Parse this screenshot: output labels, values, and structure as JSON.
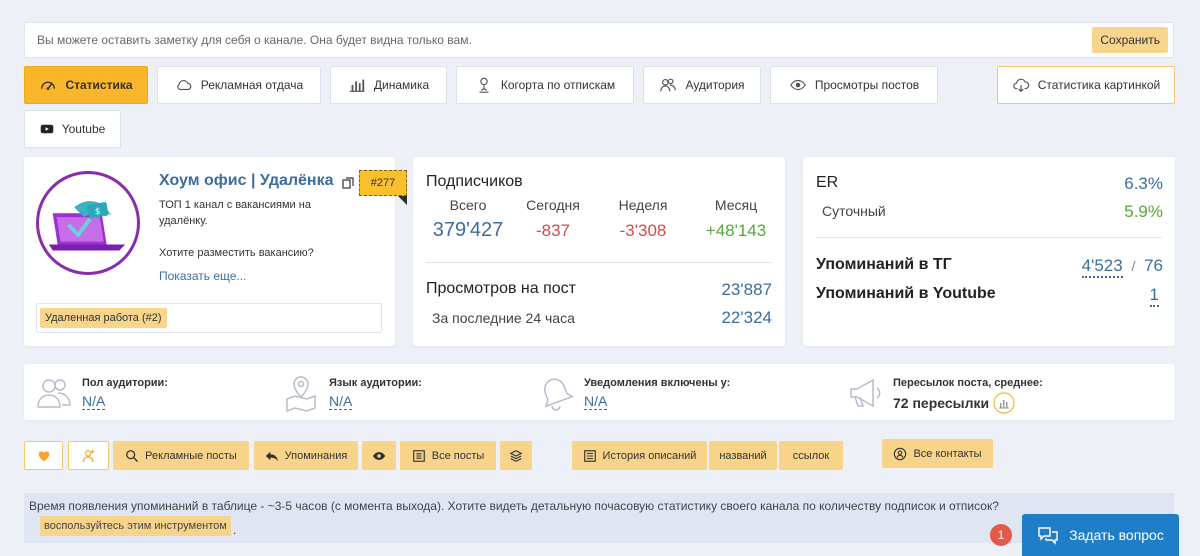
{
  "note": {
    "placeholder": "Вы можете оставить заметку для себя о канале. Она будет видна только вам.",
    "save_label": "Сохранить"
  },
  "tabs": [
    {
      "label": "Статистика",
      "icon": "speedometer-icon",
      "active": true
    },
    {
      "label": "Рекламная отдача",
      "icon": "cloud-icon"
    },
    {
      "label": "Динамика",
      "icon": "bar-chart-icon"
    },
    {
      "label": "Когорта по отпискам",
      "icon": "user-pin-icon"
    },
    {
      "label": "Аудитория",
      "icon": "users-icon"
    },
    {
      "label": "Просмотры постов",
      "icon": "eye-icon"
    },
    {
      "label": "Статистика картинкой",
      "icon": "cloud-download-icon"
    },
    {
      "label": "Youtube",
      "icon": "youtube-icon"
    }
  ],
  "channel": {
    "name": "Хоум офис | Удалёнка",
    "rank": "#277",
    "description_line1": "ТОП 1 канал с вакансиями на удалёнку.",
    "description_line2": "Хотите разместить вакансию?",
    "show_more": "Показать еще...",
    "tag": "Удаленная работа (#2)"
  },
  "subscribers": {
    "title": "Подписчиков",
    "total_label": "Всего",
    "total": "379'427",
    "today_label": "Сегодня",
    "today": "-837",
    "week_label": "Неделя",
    "week": "-3'308",
    "month_label": "Месяц",
    "month": "+48'143",
    "views_title": "Просмотров на пост",
    "views": "23'887",
    "last24_label": "За последние 24 часа",
    "last24": "22'324"
  },
  "engagement": {
    "er_label": "ER",
    "er": "6.3%",
    "daily_label": "Суточный",
    "daily": "5.9%",
    "tg_mentions_label": "Упоминаний в ТГ",
    "tg_mentions": "4'523",
    "tg_sep": "/",
    "tg_mentions2": "76",
    "yt_mentions_label": "Упоминаний в Youtube",
    "yt_mentions": "1"
  },
  "audience": {
    "gender_label": "Пол аудитории:",
    "gender": "N/A",
    "lang_label": "Язык аудитории:",
    "lang": "N/A",
    "notif_label": "Уведомления включены у:",
    "notif": "N/A",
    "forwards_label": "Пересылок поста, среднее:",
    "forwards": "72 пересылки"
  },
  "actions": {
    "ad_posts": "Рекламные посты",
    "mentions": "Упоминания",
    "all_posts": "Все посты",
    "desc_history": "История описаний",
    "names": "названий",
    "links": "ссылок",
    "all_contacts": "Все контакты"
  },
  "notice": {
    "text": "Время появления упоминаний в таблице - ~3-5 часов (с момента выхода). Хотите видеть детальную почасовую статистику своего канала по количеству подписок и отписок?",
    "link": "воспользуйтесь этим инструментом",
    "dot": "."
  },
  "chat": {
    "badge": "1",
    "label": "Задать вопрос"
  },
  "colors": {
    "accent": "#f9b62a",
    "button": "#f8d48b",
    "link": "#3c6d9e",
    "negative": "#d44b4b",
    "positive": "#57a63a",
    "chat": "#1e7ec8"
  }
}
